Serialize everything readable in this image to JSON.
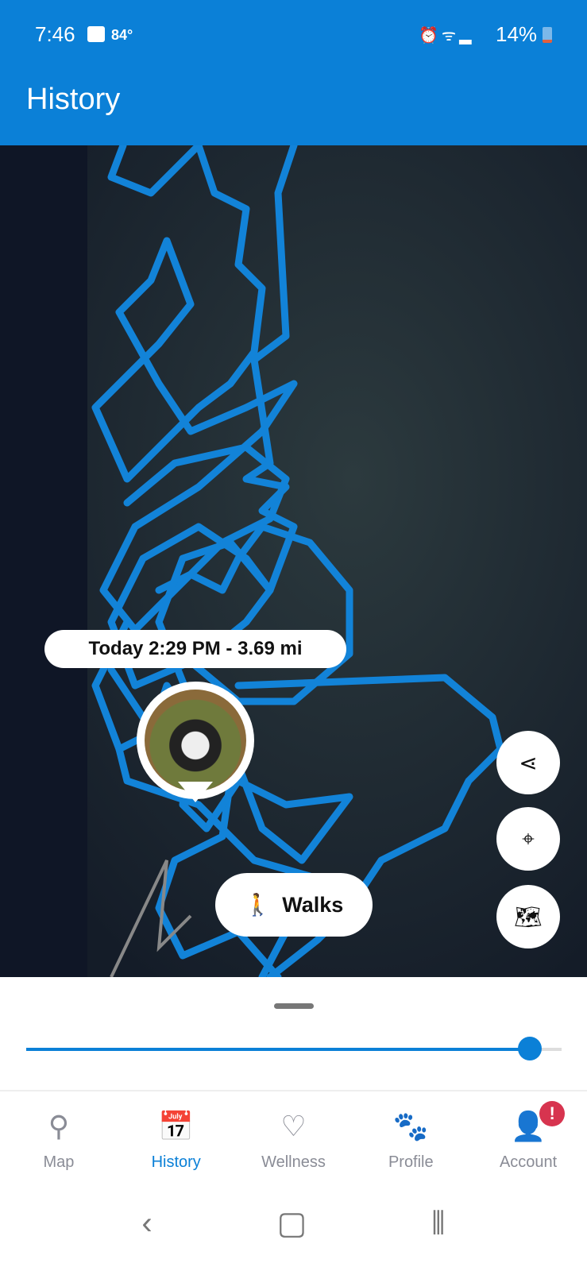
{
  "status_bar": {
    "time": "7:46",
    "temperature": "84°",
    "battery": "14%",
    "icons": [
      "gallery-icon",
      "alarm-icon",
      "wifi-icon",
      "signal-icon",
      "battery-icon"
    ]
  },
  "header": {
    "title": "History"
  },
  "map": {
    "walk_label": "Today 2:29 PM - 3.69 mi",
    "walks_button": "Walks",
    "track_color": "#1283d8",
    "buttons": [
      "share-icon",
      "location-pin-icon",
      "map-icon"
    ]
  },
  "timeline": {
    "progress_percent": 94
  },
  "nav": {
    "items": [
      {
        "label": "Map",
        "icon": "map-pin-icon"
      },
      {
        "label": "History",
        "icon": "calendar-icon",
        "active": true
      },
      {
        "label": "Wellness",
        "icon": "wellness-icon"
      },
      {
        "label": "Profile",
        "icon": "paw-icon"
      },
      {
        "label": "Account",
        "icon": "account-icon",
        "badge": "!"
      }
    ]
  },
  "accent": "#0b80d7"
}
